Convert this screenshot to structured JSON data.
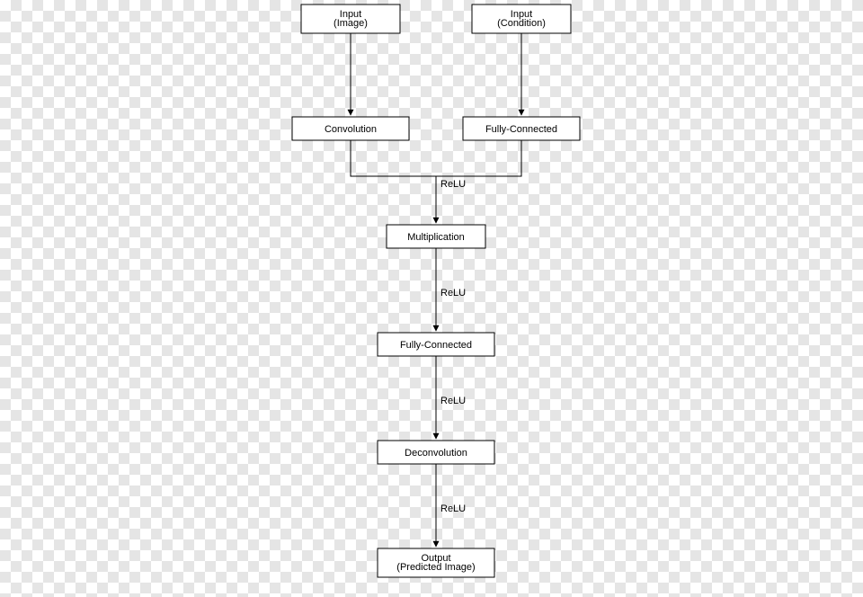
{
  "diagram": {
    "nodes": {
      "input_image": {
        "line1": "Input",
        "line2": "(Image)"
      },
      "input_cond": {
        "line1": "Input",
        "line2": "(Condition)"
      },
      "conv": {
        "label": "Convolution"
      },
      "fc1": {
        "label": "Fully-Connected"
      },
      "mult": {
        "label": "Multiplication"
      },
      "fc2": {
        "label": "Fully-Connected"
      },
      "deconv": {
        "label": "Deconvolution"
      },
      "output": {
        "line1": "Output",
        "line2": "(Predicted Image)"
      }
    },
    "edge_labels": {
      "merge_relu": "ReLU",
      "mult_relu": "ReLU",
      "fc2_relu": "ReLU",
      "deconv_relu": "ReLU"
    }
  }
}
